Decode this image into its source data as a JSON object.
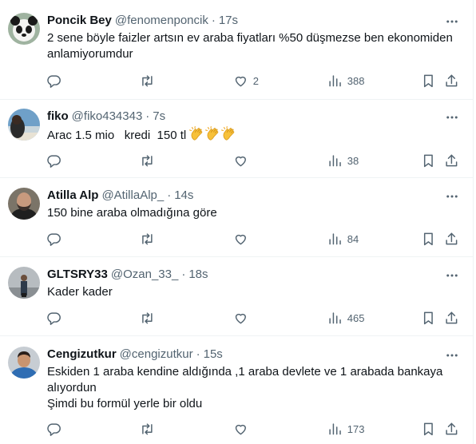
{
  "colors": {
    "primary_text": "#0f1419",
    "secondary_text": "#536471",
    "divider": "#eff3f4"
  },
  "icons": {
    "reply": "reply-icon",
    "retweet": "retweet-icon",
    "like": "heart-icon",
    "views": "views-icon",
    "bookmark": "bookmark-icon",
    "share": "share-icon",
    "more": "more-icon",
    "emoji": "clapping-hands-emoji"
  },
  "tweets": [
    {
      "name": "Poncik Bey",
      "handle": "@fenomenponcik",
      "separator": "·",
      "time": "17s",
      "lines": [
        "2 sene böyle faizler artsın ev araba fiyatları %50 düşmezse ben ekonomiden",
        "anlamiyorumdur"
      ],
      "likes": "2",
      "views": "388"
    },
    {
      "name": "fiko",
      "handle": "@fiko434343",
      "separator": "·",
      "time": "7s",
      "lines": [
        "Arac 1.5 mio   kredi  150 tl "
      ],
      "emoji_count": 3,
      "likes": "",
      "views": "38"
    },
    {
      "name": "Atilla Alp",
      "handle": "@AtillaAlp_",
      "separator": "·",
      "time": "14s",
      "lines": [
        "150 bine araba olmadığına göre"
      ],
      "likes": "",
      "views": "84"
    },
    {
      "name": "GLTSRY33",
      "handle": "@Ozan_33_",
      "separator": "·",
      "time": "18s",
      "lines": [
        "Kader kader"
      ],
      "likes": "",
      "views": "465"
    },
    {
      "name": "Cengizutkur",
      "handle": "@cengizutkur",
      "separator": "·",
      "time": "15s",
      "lines": [
        "Eskiden 1 araba kendine aldığında ,1 araba devlete ve 1 arabada bankaya",
        "alıyordun",
        "Şimdi bu formül yerle bir oldu"
      ],
      "likes": "",
      "views": "173"
    }
  ]
}
